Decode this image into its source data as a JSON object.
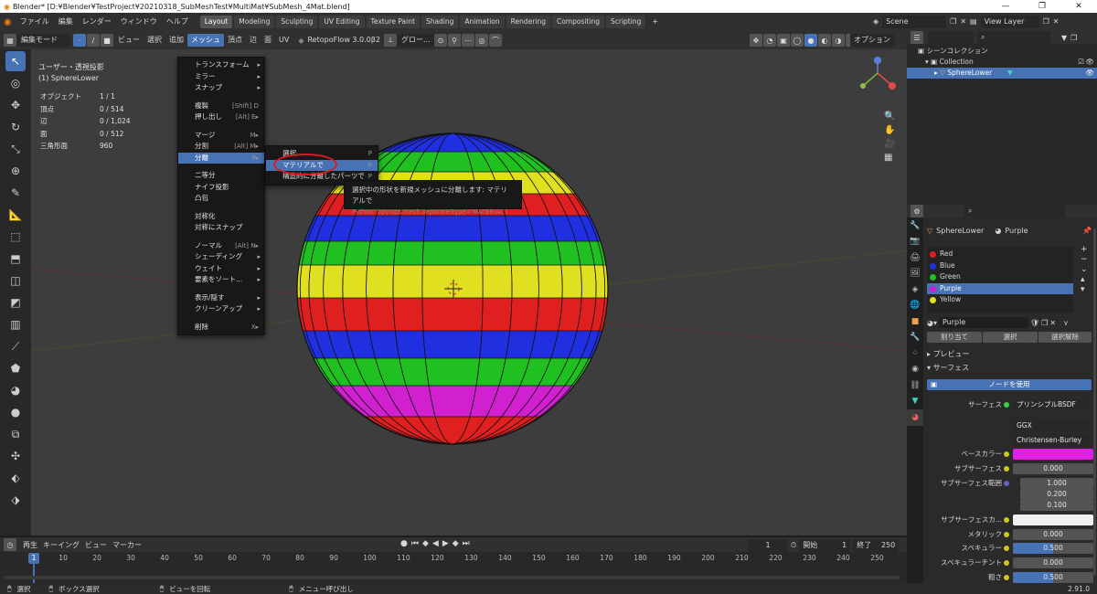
{
  "window": {
    "title": "Blender* [D:¥Blender¥TestProject¥20210318_SubMeshTest¥MultiMat¥SubMesh_4Mat.blend]",
    "minimize": "—",
    "maximize": "❐",
    "close": "✕"
  },
  "menubar": {
    "items": [
      "ファイル",
      "編集",
      "レンダー",
      "ウィンドウ",
      "ヘルプ"
    ],
    "workspaces": [
      "Layout",
      "Modeling",
      "Sculpting",
      "UV Editing",
      "Texture Paint",
      "Shading",
      "Animation",
      "Rendering",
      "Compositing",
      "Scripting"
    ],
    "scene": "Scene",
    "view_layer": "View Layer"
  },
  "viewport_header": {
    "mode": "編集モード",
    "menus": [
      "ビュー",
      "選択",
      "追加",
      "メッシュ",
      "頂点",
      "辺",
      "面",
      "UV"
    ],
    "addon": "RetopoFlow 3.0.0β2",
    "transform": "グロー...",
    "options": "オプション"
  },
  "overlay": {
    "view_name": "ユーザー・透視投影",
    "object_name": "(1) SphereLower",
    "stats": [
      {
        "label": "オブジェクト",
        "value": "1 / 1"
      },
      {
        "label": "頂点",
        "value": "0 / 514"
      },
      {
        "label": "辺",
        "value": "0 / 1,024"
      },
      {
        "label": "面",
        "value": "0 / 512"
      },
      {
        "label": "三角形面",
        "value": "960"
      }
    ]
  },
  "mesh_menu": {
    "items": [
      {
        "label": "トランスフォーム",
        "arrow": "▸"
      },
      {
        "label": "ミラー",
        "arrow": "▸"
      },
      {
        "label": "スナップ",
        "arrow": "▸"
      },
      {
        "sep": true
      },
      {
        "label": "複製",
        "shortcut": "[Shift] D"
      },
      {
        "label": "押し出し",
        "shortcut": "[Alt] E▸"
      },
      {
        "sep": true
      },
      {
        "label": "マージ",
        "shortcut": "M▸"
      },
      {
        "label": "分割",
        "shortcut": "[Alt] M▸"
      },
      {
        "label": "分離",
        "shortcut": "P▸",
        "highlight": true
      },
      {
        "sep": true
      },
      {
        "label": "二等分"
      },
      {
        "label": "ナイフ投影"
      },
      {
        "label": "凸包"
      },
      {
        "sep": true
      },
      {
        "label": "対称化"
      },
      {
        "label": "対称にスナップ"
      },
      {
        "sep": true
      },
      {
        "label": "ノーマル",
        "shortcut": "[Alt] N▸"
      },
      {
        "label": "シェーディング",
        "arrow": "▸"
      },
      {
        "label": "ウェイト",
        "arrow": "▸"
      },
      {
        "label": "要素をソート...",
        "arrow": "▸"
      },
      {
        "sep": true
      },
      {
        "label": "表示/隠す",
        "arrow": "▸"
      },
      {
        "label": "クリーンアップ",
        "arrow": "▸"
      },
      {
        "sep": true
      },
      {
        "label": "削除",
        "shortcut": "X▸"
      }
    ]
  },
  "separate_menu": {
    "items": [
      {
        "label": "選択",
        "shortcut": "P"
      },
      {
        "label": "マテリアルで",
        "shortcut": "P",
        "highlight": true
      },
      {
        "label": "構造的に分離したパーツで",
        "shortcut": "P"
      }
    ]
  },
  "tooltip": {
    "text": "選択中の形状を新規メッシュに分離します: マテリアルで",
    "python": "Python: bpy.ops.mesh.separate(type='MATERIAL')"
  },
  "outliner": {
    "title": "シーンコレクション",
    "collection": "Collection",
    "object": "SphereLower"
  },
  "properties": {
    "object": "SphereLower",
    "material": "Purple",
    "materials": [
      {
        "name": "Red",
        "color": "#e02020"
      },
      {
        "name": "Blue",
        "color": "#2030e0"
      },
      {
        "name": "Green",
        "color": "#20c020"
      },
      {
        "name": "Purple",
        "color": "#d020d0"
      },
      {
        "name": "Yellow",
        "color": "#e0e020"
      }
    ],
    "buttons": {
      "assign": "割り当て",
      "select": "選択",
      "deselect": "選択解除"
    },
    "sections": {
      "preview": "プレビュー",
      "surface": "サーフェス"
    },
    "use_nodes": "ノードを使用",
    "surface_label": "サーフェス",
    "surface_value": "プリンシプルBSDF",
    "distribution": "GGX",
    "subsurface_method": "Christensen-Burley",
    "fields": [
      {
        "label": "ベースカラー",
        "value": "",
        "color": "#e020e0"
      },
      {
        "label": "サブサーフェス",
        "value": "0.000"
      },
      {
        "label": "サブサーフェス範囲",
        "value": "1.000"
      },
      {
        "label": "",
        "value": "0.200"
      },
      {
        "label": "",
        "value": "0.100"
      },
      {
        "label": "サブサーフェスカ...",
        "value": "",
        "color": "#f0f0f0"
      },
      {
        "label": "メタリック",
        "value": "0.000"
      },
      {
        "label": "スペキュラー",
        "value": "0.500",
        "fill": 0.5
      },
      {
        "label": "スペキュラーチント",
        "value": "0.000"
      },
      {
        "label": "粗さ",
        "value": "0.500",
        "fill": 0.5
      }
    ]
  },
  "timeline": {
    "menus": [
      "再生",
      "キーイング",
      "ビュー",
      "マーカー"
    ],
    "current_frame": "1",
    "start_label": "開始",
    "start": "1",
    "end_label": "終了",
    "end": "250",
    "ticks": [
      "1",
      "10",
      "20",
      "30",
      "40",
      "50",
      "60",
      "70",
      "80",
      "90",
      "100",
      "110",
      "120",
      "130",
      "140",
      "150",
      "160",
      "170",
      "180",
      "190",
      "200",
      "210",
      "220",
      "230",
      "240",
      "250"
    ]
  },
  "statusbar": {
    "select": "選択",
    "box_select": "ボックス選択",
    "rotate_view": "ビューを回転",
    "call_menu": "メニュー呼び出し",
    "version": "2.91.0"
  }
}
